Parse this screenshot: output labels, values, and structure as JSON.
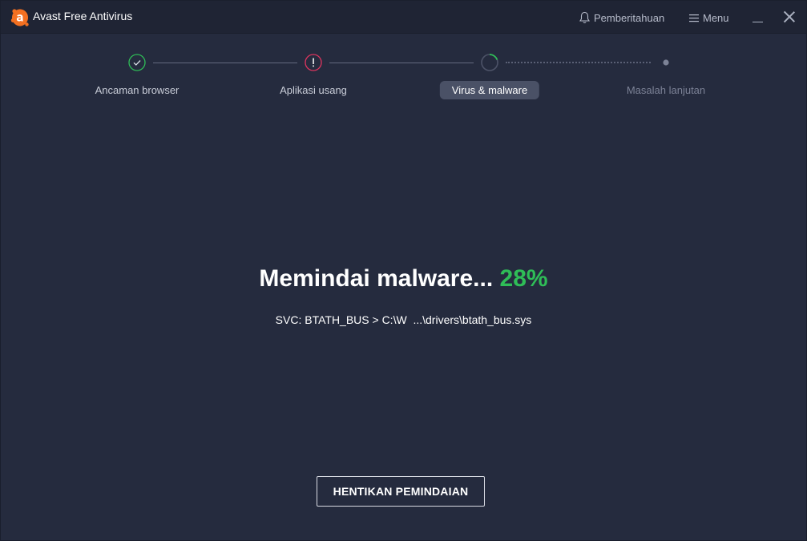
{
  "app": {
    "title": "Avast Free Antivirus",
    "accent_color": "#f37021"
  },
  "titlebar": {
    "notifications_label": "Pemberitahuan",
    "menu_label": "Menu"
  },
  "steps": [
    {
      "label": "Ancaman browser",
      "status": "done",
      "color": "#2fbd57"
    },
    {
      "label": "Aplikasi usang",
      "status": "warning",
      "color": "#e0355f"
    },
    {
      "label": "Virus & malware",
      "status": "in-progress",
      "color": "#2fbd57"
    },
    {
      "label": "Masalah lanjutan",
      "status": "pending",
      "color": "#7c8296"
    }
  ],
  "scan": {
    "heading": "Memindai malware...",
    "percent": "28%",
    "progress": 28,
    "current_item": "SVC: BTATH_BUS > C:\\W  ...\\drivers\\btath_bus.sys"
  },
  "actions": {
    "stop_label": "HENTIKAN PEMINDAIAN"
  }
}
